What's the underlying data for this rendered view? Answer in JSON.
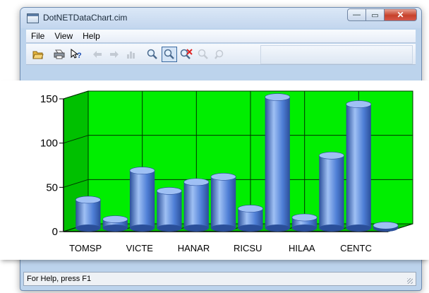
{
  "window": {
    "title": "DotNETDataChart.cim",
    "min_glyph": "—",
    "max_glyph": "▭",
    "close_glyph": "✕"
  },
  "menu": [
    "File",
    "View",
    "Help"
  ],
  "toolbar": {
    "icons": [
      "open-folder-icon",
      "print-icon",
      "help-pointer-icon",
      "back-arrow-icon",
      "forward-arrow-icon",
      "chart-type-icon",
      "zoom-icon",
      "zoom-box-icon",
      "zoom-reset-icon",
      "zoom-in-icon",
      "zoom-out-icon"
    ]
  },
  "status": {
    "text": "For Help, press F1"
  },
  "chart_data": {
    "type": "bar",
    "categories": [
      "TOMSP",
      "",
      "VICTE",
      "",
      "HANAR",
      "",
      "RICSU",
      "",
      "HILAA",
      "",
      "CENTC",
      ""
    ],
    "values": [
      32,
      10,
      65,
      42,
      52,
      58,
      22,
      148,
      12,
      82,
      140,
      3
    ],
    "ylim": [
      0,
      150
    ],
    "yticks": [
      0,
      50,
      100,
      150
    ],
    "grid": true,
    "style": "3d-cylinder",
    "colors": {
      "plot_background": "#00ee00",
      "floor": "#00c000",
      "bar": "#4f7fd6",
      "bar_highlight": "#9fc0f4",
      "bar_shadow": "#2a4f9a",
      "grid": "#003300"
    }
  }
}
